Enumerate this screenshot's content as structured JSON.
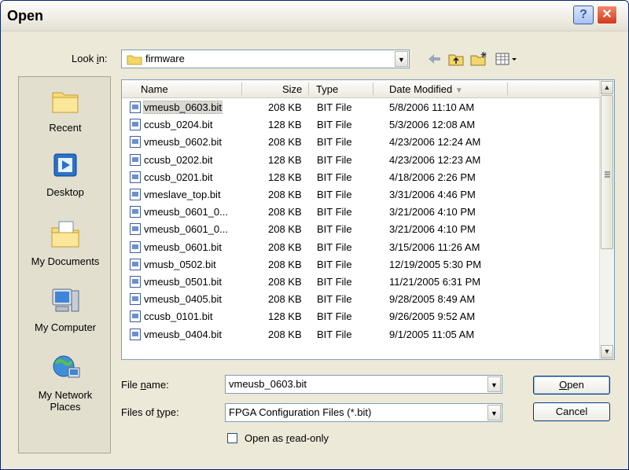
{
  "window": {
    "title": "Open",
    "help_glyph": "?",
    "close_glyph": "✕"
  },
  "look_in": {
    "label_pre": "Look ",
    "label_key": "i",
    "label_post": "n:",
    "value": "firmware",
    "icons": [
      "back-arrow-icon",
      "up-folder-icon",
      "new-folder-icon",
      "views-menu-icon"
    ]
  },
  "places": [
    {
      "label": "Recent",
      "icon": "recent-folder-icon"
    },
    {
      "label": "Desktop",
      "icon": "desktop-icon"
    },
    {
      "label": "My Documents",
      "icon": "my-documents-icon"
    },
    {
      "label": "My Computer",
      "icon": "my-computer-icon"
    },
    {
      "label": "My Network Places",
      "icon": "network-places-icon"
    }
  ],
  "file_list": {
    "columns": {
      "name": "Name",
      "size": "Size",
      "type": "Type",
      "date": "Date Modified"
    },
    "sort_glyph": "▼",
    "rows": [
      {
        "name": "vmeusb_0603.bit",
        "size": "208 KB",
        "type": "BIT File",
        "date": "5/8/2006 11:10 AM"
      },
      {
        "name": "ccusb_0204.bit",
        "size": "128 KB",
        "type": "BIT File",
        "date": "5/3/2006 12:08 AM"
      },
      {
        "name": "vmeusb_0602.bit",
        "size": "208 KB",
        "type": "BIT File",
        "date": "4/23/2006 12:24 AM"
      },
      {
        "name": "ccusb_0202.bit",
        "size": "128 KB",
        "type": "BIT File",
        "date": "4/23/2006 12:23 AM"
      },
      {
        "name": "ccusb_0201.bit",
        "size": "128 KB",
        "type": "BIT File",
        "date": "4/18/2006 2:26 PM"
      },
      {
        "name": "vmeslave_top.bit",
        "size": "208 KB",
        "type": "BIT File",
        "date": "3/31/2006 4:46 PM"
      },
      {
        "name": "vmeusb_0601_0...",
        "size": "208 KB",
        "type": "BIT File",
        "date": "3/21/2006 4:10 PM"
      },
      {
        "name": "vmeusb_0601_0...",
        "size": "208 KB",
        "type": "BIT File",
        "date": "3/21/2006 4:10 PM"
      },
      {
        "name": "vmeusb_0601.bit",
        "size": "208 KB",
        "type": "BIT File",
        "date": "3/15/2006 11:26 AM"
      },
      {
        "name": "vmusb_0502.bit",
        "size": "208 KB",
        "type": "BIT File",
        "date": "12/19/2005 5:30 PM"
      },
      {
        "name": "vmeusb_0501.bit",
        "size": "208 KB",
        "type": "BIT File",
        "date": "11/21/2005 6:31 PM"
      },
      {
        "name": "vmeusb_0405.bit",
        "size": "208 KB",
        "type": "BIT File",
        "date": "9/28/2005 8:49 AM"
      },
      {
        "name": "ccusb_0101.bit",
        "size": "128 KB",
        "type": "BIT File",
        "date": "9/26/2005 9:52 AM"
      },
      {
        "name": "vmeusb_0404.bit",
        "size": "208 KB",
        "type": "BIT File",
        "date": "9/1/2005 11:05 AM"
      }
    ]
  },
  "file_name": {
    "label_pre": "File ",
    "label_key": "n",
    "label_post": "ame:",
    "value": "vmeusb_0603.bit"
  },
  "files_of_type": {
    "label_pre": "Files of ",
    "label_key": "t",
    "label_post": "ype:",
    "value": "FPGA Configuration Files (*.bit)"
  },
  "read_only": {
    "label_pre": "Open as ",
    "label_key": "r",
    "label_post": "ead-only",
    "checked": false
  },
  "buttons": {
    "open_key": "O",
    "open_rest": "pen",
    "cancel": "Cancel"
  }
}
